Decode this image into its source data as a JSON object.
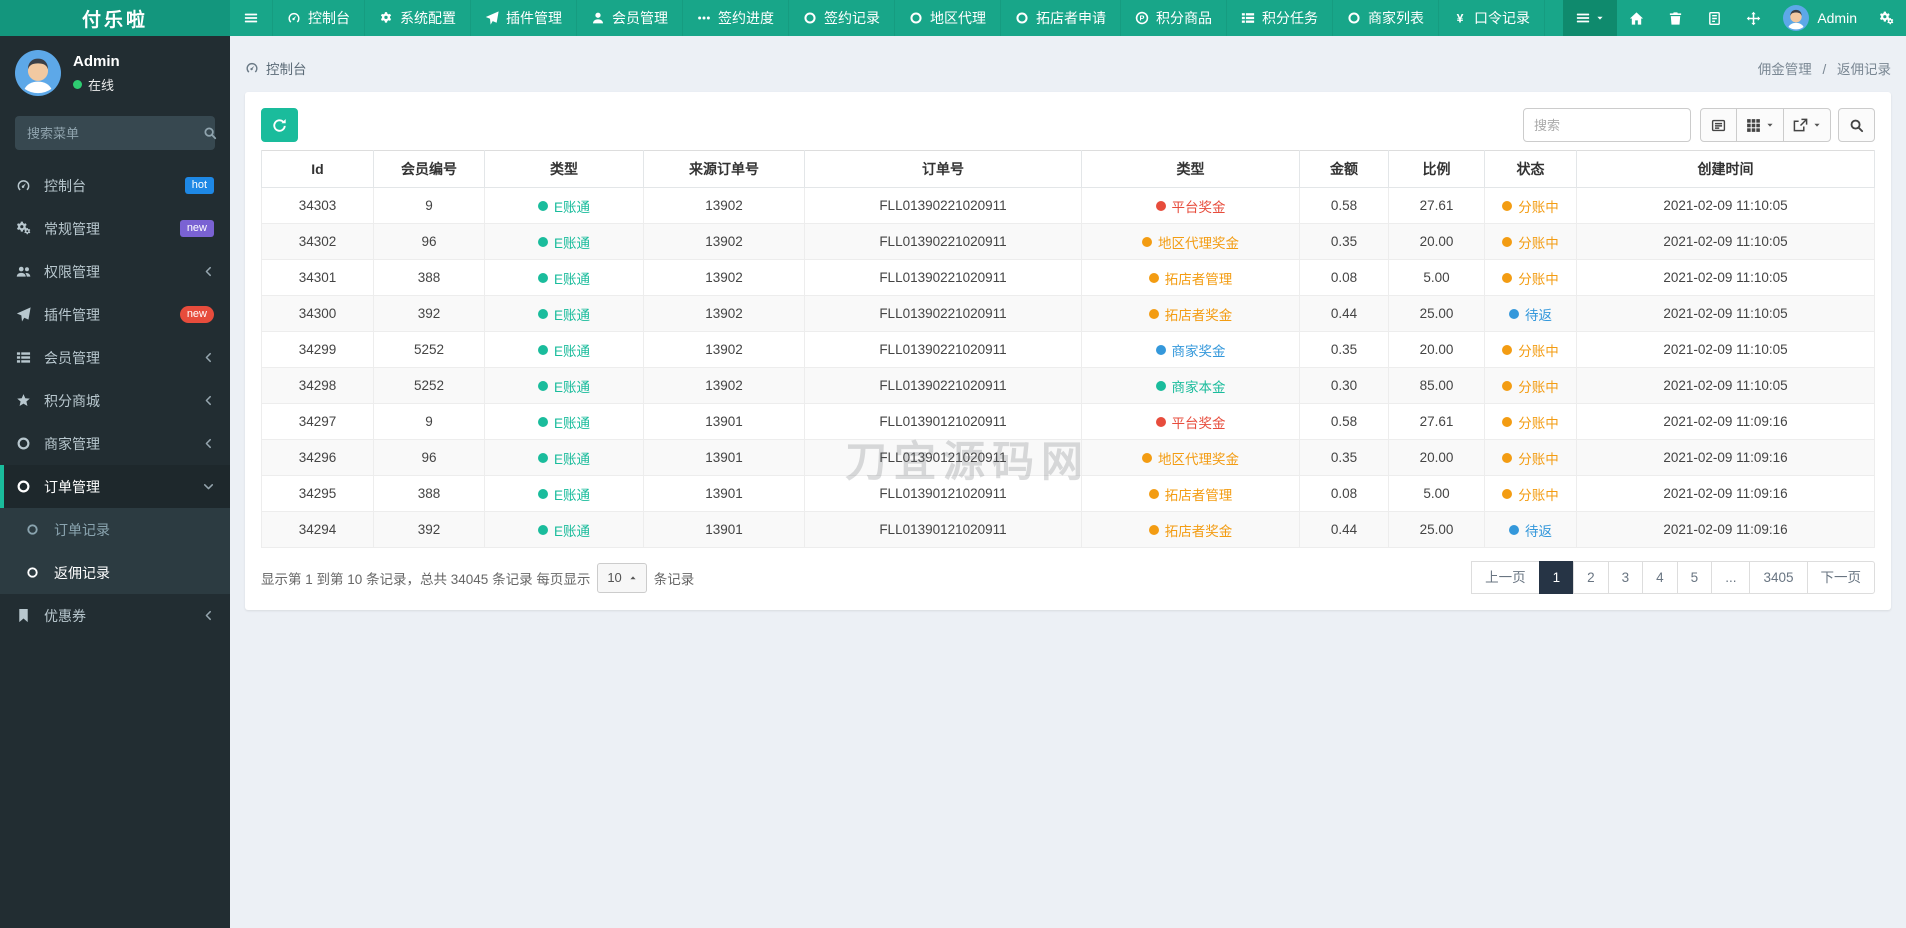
{
  "brand": {
    "title": "付乐啦"
  },
  "colors": {
    "navbar": "#18a689",
    "brand_bg": "#13967d",
    "sidebar_bg": "#222d32",
    "accent": "#1abc9c",
    "red": "#e74c3c",
    "orange": "#f39c12",
    "blue": "#3498db",
    "pagination_active": "#263445"
  },
  "topnav": {
    "items": [
      {
        "icon": "bars",
        "label": ""
      },
      {
        "icon": "gauge",
        "label": "控制台"
      },
      {
        "icon": "gear",
        "label": "系统配置"
      },
      {
        "icon": "plane",
        "label": "插件管理"
      },
      {
        "icon": "user",
        "label": "会员管理"
      },
      {
        "icon": "ellipsis",
        "label": "签约进度"
      },
      {
        "icon": "circle",
        "label": "签约记录"
      },
      {
        "icon": "circle",
        "label": "地区代理"
      },
      {
        "icon": "circle",
        "label": "拓店者申请"
      },
      {
        "icon": "p-circle",
        "label": "积分商品"
      },
      {
        "icon": "tasks",
        "label": "积分任务"
      },
      {
        "icon": "circle",
        "label": "商家列表"
      },
      {
        "icon": "yen",
        "label": "口令记录"
      }
    ],
    "right_icons": [
      {
        "icon": "home"
      },
      {
        "icon": "trash"
      },
      {
        "icon": "log"
      },
      {
        "icon": "arrows"
      }
    ],
    "user": "Admin"
  },
  "sidebar": {
    "user": {
      "name": "Admin",
      "status": "在线"
    },
    "search_placeholder": "搜索菜单",
    "items": [
      {
        "icon": "gauge",
        "label": "控制台",
        "badge": {
          "text": "hot",
          "color": "blue"
        }
      },
      {
        "icon": "cogs",
        "label": "常规管理",
        "badge": {
          "text": "new",
          "color": "purple"
        }
      },
      {
        "icon": "users",
        "label": "权限管理",
        "chevron": "chevron-left"
      },
      {
        "icon": "plane",
        "label": "插件管理",
        "badge": {
          "text": "new",
          "color": "red"
        }
      },
      {
        "icon": "tasks",
        "label": "会员管理",
        "chevron": "chevron-left"
      },
      {
        "icon": "star",
        "label": "积分商城",
        "chevron": "chevron-left"
      },
      {
        "icon": "circle",
        "label": "商家管理",
        "chevron": "chevron-left"
      },
      {
        "icon": "circle",
        "label": "订单管理",
        "chevron": "chevron-down",
        "active": true
      },
      {
        "icon": "circle",
        "label": "订单记录",
        "sub": true,
        "muted": true
      },
      {
        "icon": "circle",
        "label": "返佣记录",
        "sub": true,
        "selected": true
      },
      {
        "icon": "bookmark",
        "label": "优惠券",
        "chevron": "chevron-left"
      }
    ]
  },
  "breadcrumb": {
    "left": "控制台",
    "parent": "佣金管理",
    "separator": "/",
    "current": "返佣记录"
  },
  "toolbar": {
    "search_placeholder": "搜索"
  },
  "table": {
    "headers": [
      "Id",
      "会员编号",
      "类型",
      "来源订单号",
      "订单号",
      "类型",
      "金额",
      "比例",
      "状态",
      "创建时间"
    ],
    "rows": [
      {
        "id": "34303",
        "member": "9",
        "type": {
          "label": "E账通",
          "color": "green"
        },
        "source": "13902",
        "order": "FLL01390221020911",
        "type2": {
          "label": "平台奖金",
          "color": "red"
        },
        "amount": "0.58",
        "ratio": "27.61",
        "status": {
          "label": "分账中",
          "color": "orange"
        },
        "created": "2021-02-09 11:10:05"
      },
      {
        "id": "34302",
        "member": "96",
        "type": {
          "label": "E账通",
          "color": "green"
        },
        "source": "13902",
        "order": "FLL01390221020911",
        "type2": {
          "label": "地区代理奖金",
          "color": "orange"
        },
        "amount": "0.35",
        "ratio": "20.00",
        "status": {
          "label": "分账中",
          "color": "orange"
        },
        "created": "2021-02-09 11:10:05"
      },
      {
        "id": "34301",
        "member": "388",
        "type": {
          "label": "E账通",
          "color": "green"
        },
        "source": "13902",
        "order": "FLL01390221020911",
        "type2": {
          "label": "拓店者管理",
          "color": "orange"
        },
        "amount": "0.08",
        "ratio": "5.00",
        "status": {
          "label": "分账中",
          "color": "orange"
        },
        "created": "2021-02-09 11:10:05"
      },
      {
        "id": "34300",
        "member": "392",
        "type": {
          "label": "E账通",
          "color": "green"
        },
        "source": "13902",
        "order": "FLL01390221020911",
        "type2": {
          "label": "拓店者奖金",
          "color": "orange"
        },
        "amount": "0.44",
        "ratio": "25.00",
        "status": {
          "label": "待返",
          "color": "blue"
        },
        "created": "2021-02-09 11:10:05"
      },
      {
        "id": "34299",
        "member": "5252",
        "type": {
          "label": "E账通",
          "color": "green"
        },
        "source": "13902",
        "order": "FLL01390221020911",
        "type2": {
          "label": "商家奖金",
          "color": "blue"
        },
        "amount": "0.35",
        "ratio": "20.00",
        "status": {
          "label": "分账中",
          "color": "orange"
        },
        "created": "2021-02-09 11:10:05"
      },
      {
        "id": "34298",
        "member": "5252",
        "type": {
          "label": "E账通",
          "color": "green"
        },
        "source": "13902",
        "order": "FLL01390221020911",
        "type2": {
          "label": "商家本金",
          "color": "green"
        },
        "amount": "0.30",
        "ratio": "85.00",
        "status": {
          "label": "分账中",
          "color": "orange"
        },
        "created": "2021-02-09 11:10:05"
      },
      {
        "id": "34297",
        "member": "9",
        "type": {
          "label": "E账通",
          "color": "green"
        },
        "source": "13901",
        "order": "FLL01390121020911",
        "type2": {
          "label": "平台奖金",
          "color": "red"
        },
        "amount": "0.58",
        "ratio": "27.61",
        "status": {
          "label": "分账中",
          "color": "orange"
        },
        "created": "2021-02-09 11:09:16"
      },
      {
        "id": "34296",
        "member": "96",
        "type": {
          "label": "E账通",
          "color": "green"
        },
        "source": "13901",
        "order": "FLL01390121020911",
        "type2": {
          "label": "地区代理奖金",
          "color": "orange"
        },
        "amount": "0.35",
        "ratio": "20.00",
        "status": {
          "label": "分账中",
          "color": "orange"
        },
        "created": "2021-02-09 11:09:16"
      },
      {
        "id": "34295",
        "member": "388",
        "type": {
          "label": "E账通",
          "color": "green"
        },
        "source": "13901",
        "order": "FLL01390121020911",
        "type2": {
          "label": "拓店者管理",
          "color": "orange"
        },
        "amount": "0.08",
        "ratio": "5.00",
        "status": {
          "label": "分账中",
          "color": "orange"
        },
        "created": "2021-02-09 11:09:16"
      },
      {
        "id": "34294",
        "member": "392",
        "type": {
          "label": "E账通",
          "color": "green"
        },
        "source": "13901",
        "order": "FLL01390121020911",
        "type2": {
          "label": "拓店者奖金",
          "color": "orange"
        },
        "amount": "0.44",
        "ratio": "25.00",
        "status": {
          "label": "待返",
          "color": "blue"
        },
        "created": "2021-02-09 11:09:16"
      }
    ]
  },
  "footer": {
    "summary_prefix": "显示第 1 到第 10 条记录，总共 34045 条记录 每页显示",
    "page_size": "10",
    "summary_suffix": "条记录",
    "pages": [
      {
        "label": "上一页"
      },
      {
        "label": "1",
        "active": true
      },
      {
        "label": "2"
      },
      {
        "label": "3"
      },
      {
        "label": "4"
      },
      {
        "label": "5"
      },
      {
        "label": "..."
      },
      {
        "label": "3405"
      },
      {
        "label": "下一页"
      }
    ]
  },
  "watermark": {
    "text": "刀宜源码网"
  }
}
